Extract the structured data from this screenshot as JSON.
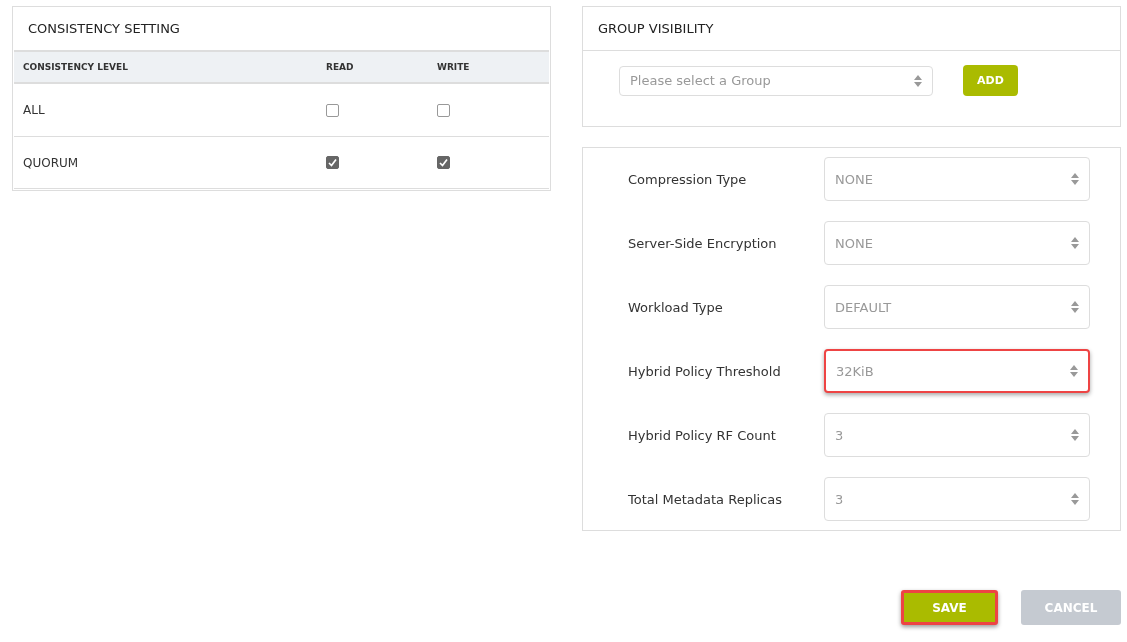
{
  "consistency": {
    "title": "CONSISTENCY SETTING",
    "columns": [
      "CONSISTENCY LEVEL",
      "READ",
      "WRITE"
    ],
    "rows": [
      {
        "level": "ALL",
        "read": false,
        "write": false
      },
      {
        "level": "QUORUM",
        "read": true,
        "write": true
      }
    ]
  },
  "group_visibility": {
    "title": "GROUP VISIBILITY",
    "select": {
      "placeholder": "Please select a Group"
    },
    "add_button": "ADD"
  },
  "settings": [
    {
      "label": "Compression Type",
      "value": "NONE",
      "highlighted": false
    },
    {
      "label": "Server-Side Encryption",
      "value": "NONE",
      "highlighted": false
    },
    {
      "label": "Workload Type",
      "value": "DEFAULT",
      "highlighted": false
    },
    {
      "label": "Hybrid Policy Threshold",
      "value": "32KiB",
      "highlighted": true
    },
    {
      "label": "Hybrid Policy RF Count",
      "value": "3",
      "highlighted": false
    },
    {
      "label": "Total Metadata Replicas",
      "value": "3",
      "highlighted": false
    }
  ],
  "buttons": [
    {
      "label": "SAVE",
      "kind": "primary",
      "highlighted": true
    },
    {
      "label": "CANCEL",
      "kind": "secondary",
      "highlighted": false
    }
  ]
}
